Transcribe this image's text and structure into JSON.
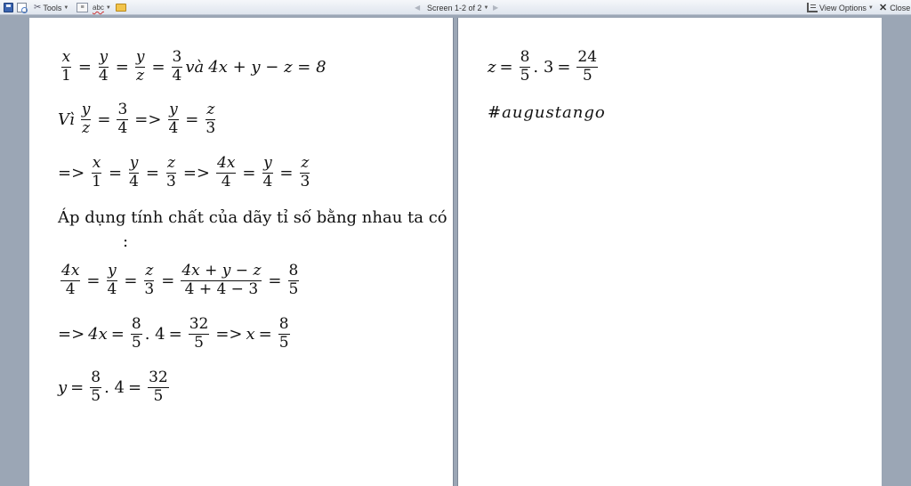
{
  "toolbar": {
    "tools_label": "Tools",
    "screen_label": "Screen 1-2 of 2",
    "view_options_label": "View Options",
    "close_label": "Close"
  },
  "page1": {
    "line1": {
      "f1n": "x",
      "f1d": "1",
      "f2n": "y",
      "f2d": "4",
      "f3n": "y",
      "f3d": "z",
      "f4n": "3",
      "f4d": "4",
      "va": "và",
      "expr": "4x + y − z = 8"
    },
    "line2": {
      "vi": "Vì",
      "f1n": "y",
      "f1d": "z",
      "f2n": "3",
      "f2d": "4",
      "arrow": "=>",
      "f3n": "y",
      "f3d": "4",
      "f4n": "z",
      "f4d": "3"
    },
    "line3": {
      "arrow1": "=>",
      "f1n": "x",
      "f1d": "1",
      "f2n": "y",
      "f2d": "4",
      "f3n": "z",
      "f3d": "3",
      "arrow2": "=>",
      "f4n": "4x",
      "f4d": "4",
      "f5n": "y",
      "f5d": "4",
      "f6n": "z",
      "f6d": "3"
    },
    "sentence": "Áp dụng tính chất của dãy tỉ số bằng nhau ta có",
    "colon": ":",
    "line4": {
      "f1n": "4x",
      "f1d": "4",
      "f2n": "y",
      "f2d": "4",
      "f3n": "z",
      "f3d": "3",
      "f4n": "4x + y − z",
      "f4d": "4 + 4 − 3",
      "f5n": "8",
      "f5d": "5"
    },
    "line5": {
      "arrow1": "=>",
      "lhs": "4x",
      "f1n": "8",
      "f1d": "5",
      "mul": ". 4",
      "f2n": "32",
      "f2d": "5",
      "arrow2": "=>",
      "var": "x",
      "f3n": "8",
      "f3d": "5"
    },
    "line6": {
      "var": "y",
      "f1n": "8",
      "f1d": "5",
      "mul": ". 4",
      "f2n": "32",
      "f2d": "5"
    }
  },
  "page2": {
    "line1": {
      "var": "z",
      "f1n": "8",
      "f1d": "5",
      "mul": ". 3",
      "f2n": "24",
      "f2d": "5"
    },
    "hashtag": "#augustango"
  }
}
